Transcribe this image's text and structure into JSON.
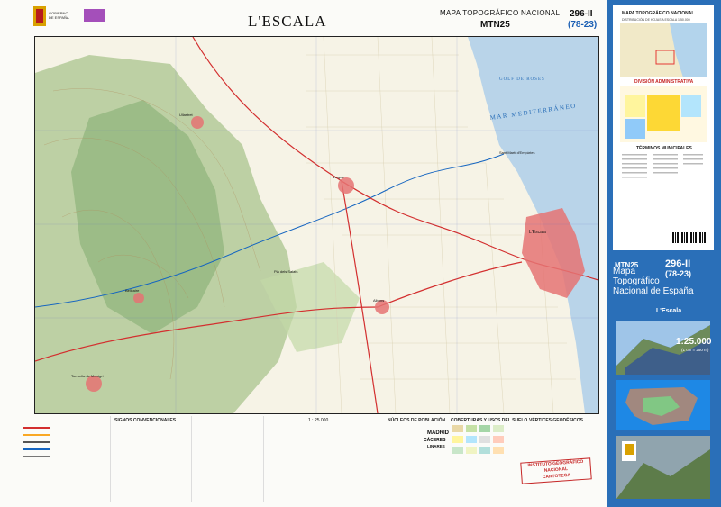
{
  "header": {
    "title": "L'ESCALA",
    "series": "MAPA TOPOGRÁFICO NACIONAL",
    "mtn": "MTN25",
    "sheet_number": "296-II",
    "sheet_grid": "(78-23)"
  },
  "map": {
    "sea_label": "MAR MEDITERRÁNEO",
    "gulf_label": "GOLF DE ROSES",
    "places": [
      {
        "name": "L'Escala"
      },
      {
        "name": "Ullastret"
      },
      {
        "name": "Verges"
      },
      {
        "name": "Torroella de Montgrí"
      },
      {
        "name": "Albons"
      },
      {
        "name": "Bellcaire"
      },
      {
        "name": "Sant Martí d'Empúries"
      },
      {
        "name": "Pla dels Salats"
      }
    ],
    "colors": {
      "sea": "#b9d4e9",
      "land": "#f6f3e6",
      "vegetation": "#a9c48e",
      "urban": "#e57373",
      "road": "#d32f2f",
      "water": "#1565c0"
    }
  },
  "legend": {
    "signos": "SIGNOS CONVENCIONALES",
    "scale": "1 : 25.000",
    "nucleos": "NÚCLEOS DE POBLACIÓN",
    "coberturas": "COBERTURAS Y USOS DEL SUELO",
    "vertices": "VÉRTICES GEODÉSICOS",
    "madrid": "MADRID",
    "caceres": "CÁCERES",
    "linares": "LINARES",
    "stamp_line1": "INSTITUTO GEOGRÁFICO",
    "stamp_line2": "NACIONAL",
    "stamp_line3": "CARTOTECA"
  },
  "panel": {
    "title": "MAPA TOPOGRÁFICO NACIONAL",
    "subtitle": "DISTRIBUCIÓN DE HOJAS A ESCALA 1:50.000",
    "admin": "DIVISIÓN ADMINISTRATIVA",
    "municipios": "TÉRMINOS MUNICIPALES",
    "mtn": "MTN25",
    "sheet_number": "296-II",
    "sheet_grid": "(78-23)",
    "big_title_1": "Mapa",
    "big_title_2": "Topográfico",
    "big_title_3": "Nacional de España",
    "place": "L'Escala",
    "scale": "1:25.000",
    "scale_note": "(1 cm = 250 m)"
  }
}
